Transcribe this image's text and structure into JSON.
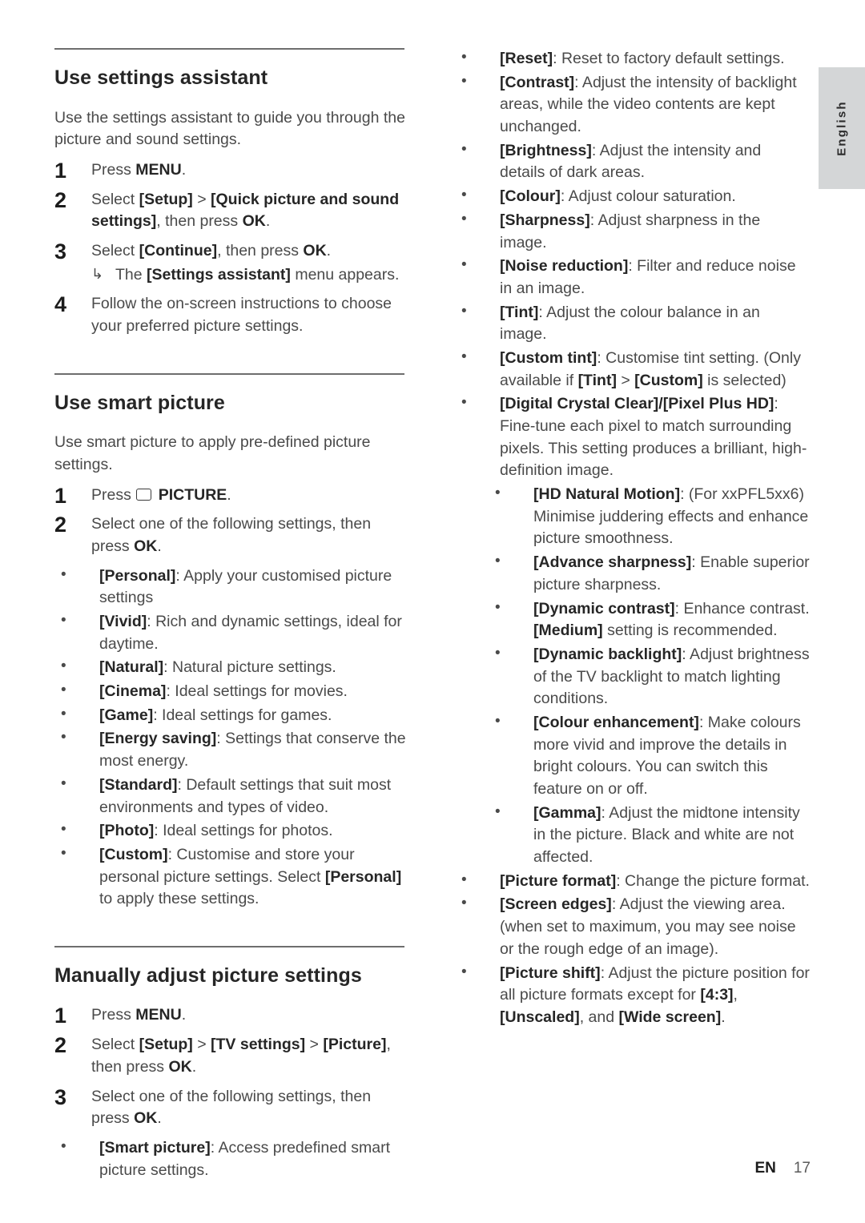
{
  "language_tab": {
    "label": "English"
  },
  "footer": {
    "locale": "EN",
    "page_number": "17"
  },
  "left_column": {
    "section1": {
      "heading": "Use settings assistant",
      "intro": "Use the settings assistant to guide you through the picture and sound settings.",
      "steps": [
        {
          "num": "1",
          "html": "Press <b>MENU</b>."
        },
        {
          "num": "2",
          "html": "Select <b>[Setup]</b> &gt; <b>[Quick picture and sound settings]</b>, then press <b>OK</b>."
        },
        {
          "num": "3",
          "html": "Select <b>[Continue]</b>, then press <b>OK</b>.",
          "substep": {
            "arrow": "↳",
            "html": "The <b>[Settings assistant]</b> menu appears."
          }
        },
        {
          "num": "4",
          "html": "Follow the on-screen instructions to choose your preferred picture settings."
        }
      ]
    },
    "section2": {
      "heading": "Use smart picture",
      "intro": "Use smart picture to apply pre-defined picture settings.",
      "steps": [
        {
          "num": "1",
          "html": "Press <span class=\"pic-icon\" data-name=\"picture-button-icon\"></span> <b>PICTURE</b>."
        },
        {
          "num": "2",
          "html": "Select one of the following settings, then press <b>OK</b>."
        }
      ],
      "bullets": [
        {
          "dot": "•",
          "html": "<b>[Personal]</b>: Apply your customised picture settings"
        },
        {
          "dot": "•",
          "html": "<b>[Vivid]</b>: Rich and dynamic settings, ideal for daytime."
        },
        {
          "dot": "•",
          "html": "<b>[Natural]</b>: Natural picture settings."
        },
        {
          "dot": "•",
          "html": "<b>[Cinema]</b>: Ideal settings for movies."
        },
        {
          "dot": "•",
          "html": "<b>[Game]</b>: Ideal settings for games."
        },
        {
          "dot": "•",
          "html": "<b>[Energy saving]</b>: Settings that conserve the most energy."
        },
        {
          "dot": "•",
          "html": "<b>[Standard]</b>: Default settings that suit most environments and types of video."
        },
        {
          "dot": "•",
          "html": "<b>[Photo]</b>: Ideal settings for photos."
        },
        {
          "dot": "•",
          "html": "<b>[Custom]</b>: Customise and store your personal picture settings. Select <b>[Personal]</b> to apply these settings."
        }
      ]
    },
    "section3": {
      "heading": "Manually adjust picture settings",
      "steps": [
        {
          "num": "1",
          "html": "Press <b>MENU</b>."
        },
        {
          "num": "2",
          "html": "Select <b>[Setup]</b> &gt; <b>[TV settings]</b> &gt; <b>[Picture]</b>, then press <b>OK</b>."
        },
        {
          "num": "3",
          "html": "Select one of the following settings, then press <b>OK</b>."
        }
      ],
      "bullets": [
        {
          "dot": "•",
          "html": "<b>[Smart picture]</b>: Access predefined smart picture settings."
        }
      ]
    }
  },
  "right_column": {
    "bullets": [
      {
        "dot": "•",
        "nested": false,
        "html": "<b>[Reset]</b>: Reset to factory default settings."
      },
      {
        "dot": "•",
        "nested": false,
        "html": "<b>[Contrast]</b>: Adjust the intensity of backlight areas, while the video contents are kept unchanged."
      },
      {
        "dot": "•",
        "nested": false,
        "html": "<b>[Brightness]</b>: Adjust the intensity and details of dark areas."
      },
      {
        "dot": "•",
        "nested": false,
        "html": "<b>[Colour]</b>: Adjust colour saturation."
      },
      {
        "dot": "•",
        "nested": false,
        "html": "<b>[Sharpness]</b>: Adjust sharpness in the image."
      },
      {
        "dot": "•",
        "nested": false,
        "html": "<b>[Noise reduction]</b>: Filter and reduce noise in an image."
      },
      {
        "dot": "•",
        "nested": false,
        "html": "<b>[Tint]</b>: Adjust the colour balance in an image."
      },
      {
        "dot": "•",
        "nested": false,
        "html": "<b>[Custom tint]</b>: Customise tint setting. (Only available if <b>[Tint]</b> &gt; <b>[Custom]</b> is selected)"
      },
      {
        "dot": "•",
        "nested": false,
        "html": "<b>[Digital Crystal Clear]/[Pixel Plus HD]</b>: Fine-tune each pixel to match surrounding pixels. This setting produces a brilliant, high-definition image."
      },
      {
        "dot": "•",
        "nested": true,
        "html": "<b>[HD Natural Motion]</b>: (For xxPFL5xx6) Minimise juddering effects and enhance picture smoothness."
      },
      {
        "dot": "•",
        "nested": true,
        "html": "<b>[Advance sharpness]</b>: Enable superior picture sharpness."
      },
      {
        "dot": "•",
        "nested": true,
        "html": "<b>[Dynamic contrast]</b>: Enhance contrast. <b>[Medium]</b> setting is recommended."
      },
      {
        "dot": "•",
        "nested": true,
        "html": "<b>[Dynamic backlight]</b>: Adjust brightness of the TV backlight to match lighting conditions."
      },
      {
        "dot": "•",
        "nested": true,
        "html": "<b>[Colour enhancement]</b>: Make colours more vivid and improve the details in bright colours. You can switch this feature on or off."
      },
      {
        "dot": "•",
        "nested": true,
        "html": "<b>[Gamma]</b>: Adjust the midtone intensity in the picture. Black and white are not affected."
      },
      {
        "dot": "•",
        "nested": false,
        "html": "<b>[Picture format]</b>: Change the picture format."
      },
      {
        "dot": "•",
        "nested": false,
        "html": "<b>[Screen edges]</b>: Adjust the viewing area. (when set to maximum, you may see noise or the rough edge of an image)."
      },
      {
        "dot": "•",
        "nested": false,
        "html": "<b>[Picture shift]</b>: Adjust the picture position for all picture formats except for <b>[4:3]</b>, <b>[Unscaled]</b>, and <b>[Wide screen]</b>."
      }
    ]
  }
}
